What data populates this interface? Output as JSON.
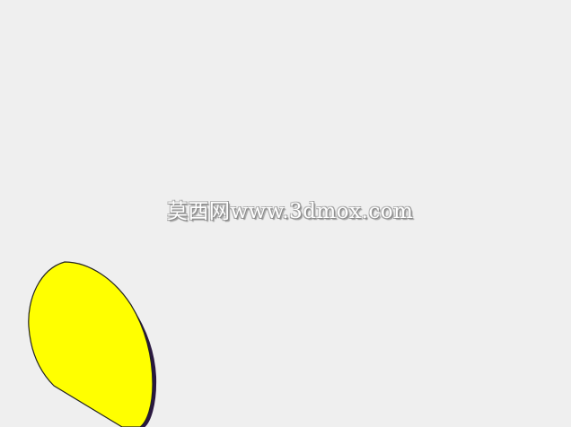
{
  "watermark": {
    "text": "莫西网www.3dmox.com"
  },
  "scene": {
    "background_color": "#efefef",
    "shape_fill_color": "#ffff00",
    "shape_outline_color": "#222222",
    "shape_edge_color": "#2a1840"
  }
}
